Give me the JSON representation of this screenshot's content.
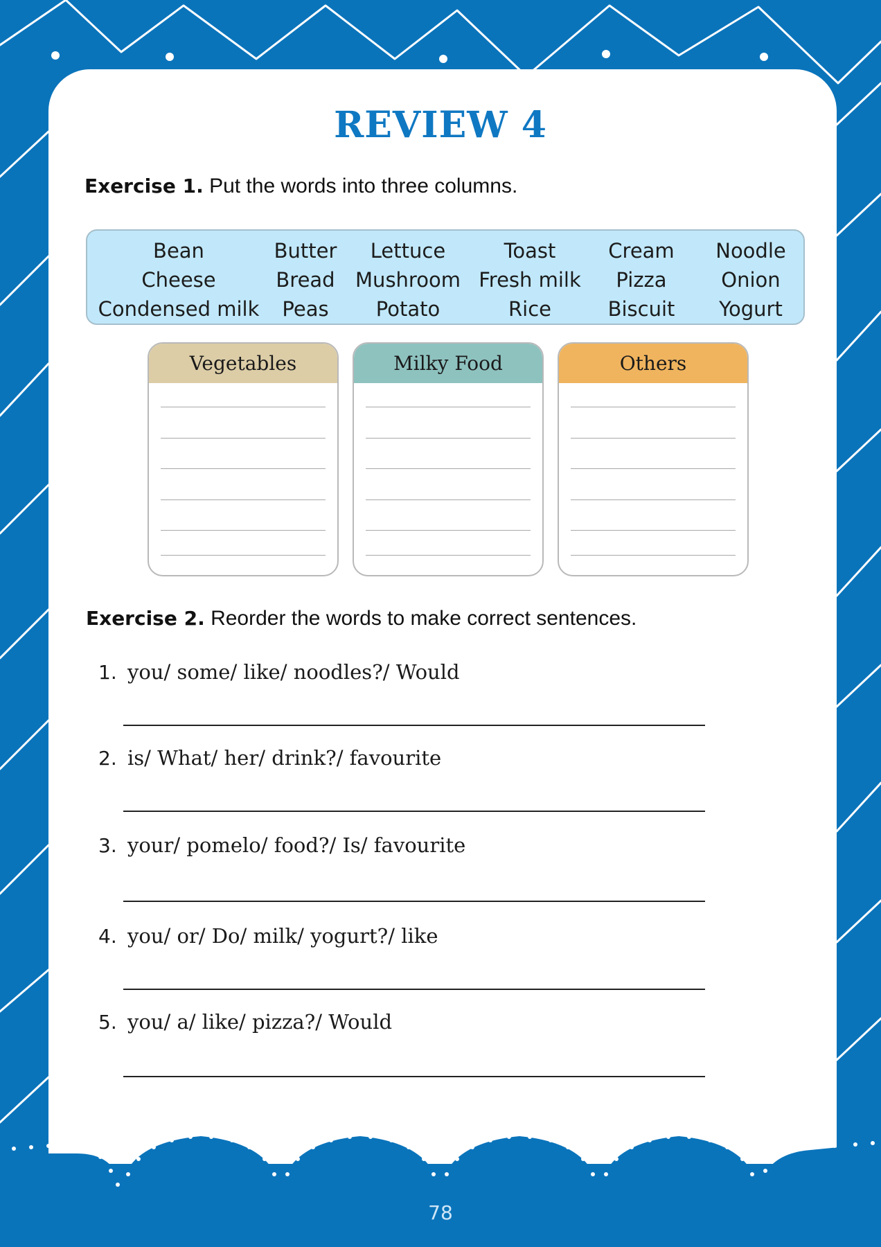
{
  "colors": {
    "background": "#0a74bb",
    "title": "#0f78c2",
    "word_bank_fill": "#c1e8fa",
    "vegetables_header": "#dccda7",
    "milky_header": "#8ec2bf",
    "others_header": "#f0b45e"
  },
  "title": "REVIEW 4",
  "exercise1": {
    "label": "Exercise 1.",
    "instruction": "Put the words into three columns.",
    "word_bank": [
      [
        "Bean",
        "Cheese",
        "Condensed milk"
      ],
      [
        "Butter",
        "Bread",
        "Peas"
      ],
      [
        "Lettuce",
        "Mushroom",
        "Potato"
      ],
      [
        "Toast",
        "Fresh milk",
        "Rice"
      ],
      [
        "Cream",
        "Pizza",
        "Biscuit"
      ],
      [
        "Noodle",
        "Onion",
        "Yogurt"
      ]
    ],
    "columns": [
      "Vegetables",
      "Milky Food",
      "Others"
    ]
  },
  "exercise2": {
    "label": "Exercise 2.",
    "instruction": "Reorder the words to make correct sentences.",
    "questions": [
      {
        "num": "1.",
        "text": "you/ some/ like/ noodles?/ Would"
      },
      {
        "num": "2.",
        "text": "is/ What/ her/ drink?/ favourite"
      },
      {
        "num": "3.",
        "text": "your/ pomelo/ food?/ Is/ favourite"
      },
      {
        "num": "4.",
        "text": "you/ or/ Do/ milk/ yogurt?/ like"
      },
      {
        "num": "5.",
        "text": "you/ a/ like/ pizza?/ Would"
      }
    ]
  },
  "page_number": "78"
}
